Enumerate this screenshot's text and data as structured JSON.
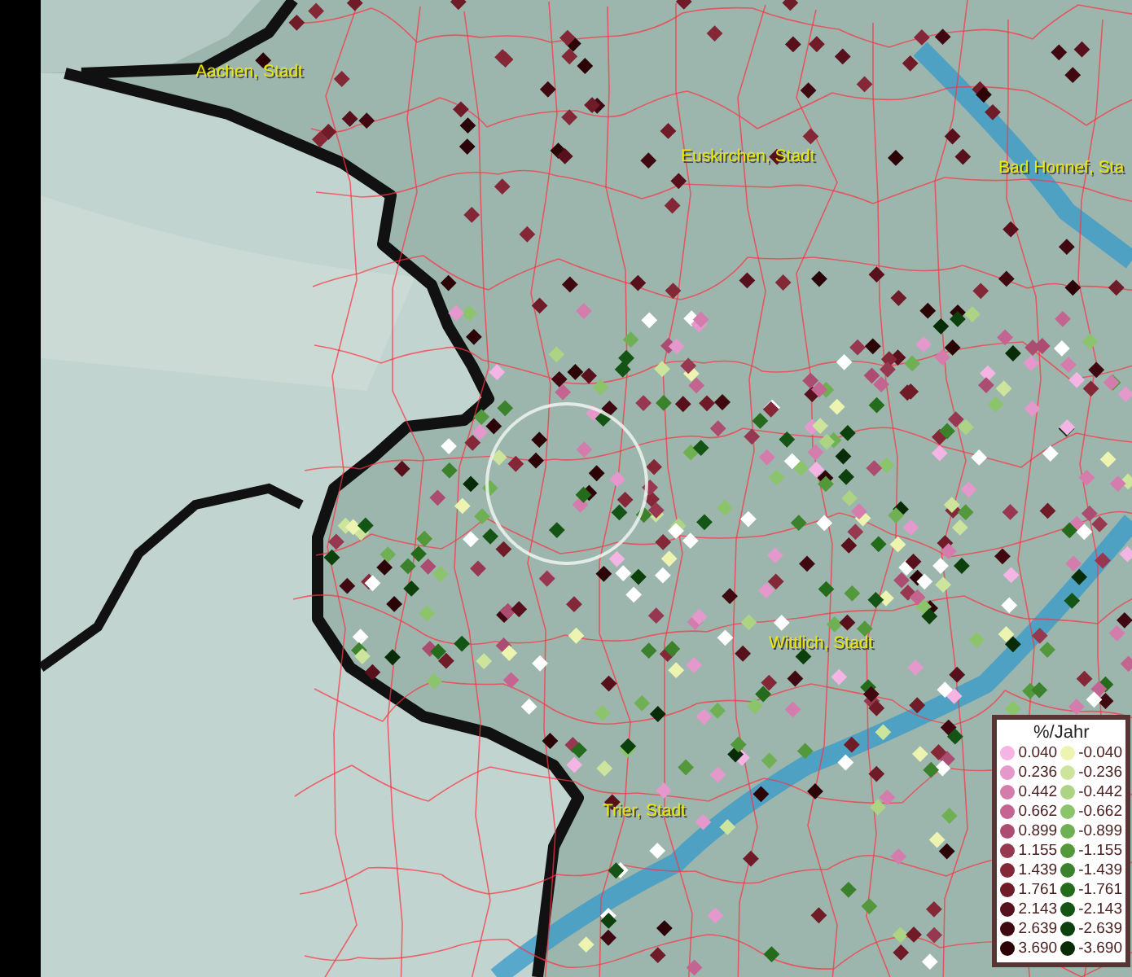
{
  "map": {
    "places": [
      {
        "name": "Aachen, Stadt"
      },
      {
        "name": "Euskirchen, Stadt"
      },
      {
        "name": "Bad Honnef, Sta"
      },
      {
        "name": "Wittlich, Stadt"
      },
      {
        "name": "Trier, Stadt"
      }
    ]
  },
  "legend": {
    "title": "%/Jahr",
    "positive": [
      {
        "value": "0.040",
        "color": "#f4b4e4"
      },
      {
        "value": "0.236",
        "color": "#e498cc"
      },
      {
        "value": "0.442",
        "color": "#d47cac"
      },
      {
        "value": "0.662",
        "color": "#c46490"
      },
      {
        "value": "0.899",
        "color": "#ac4c70"
      },
      {
        "value": "1.155",
        "color": "#983850"
      },
      {
        "value": "1.439",
        "color": "#842838"
      },
      {
        "value": "1.761",
        "color": "#701c28"
      },
      {
        "value": "2.143",
        "color": "#58101c"
      },
      {
        "value": "2.639",
        "color": "#400810"
      },
      {
        "value": "3.690",
        "color": "#2c0408"
      }
    ],
    "negative": [
      {
        "value": "-0.040",
        "color": "#ecf4b0"
      },
      {
        "value": "-0.236",
        "color": "#cce49c"
      },
      {
        "value": "-0.442",
        "color": "#acd484"
      },
      {
        "value": "-0.662",
        "color": "#8cc46c"
      },
      {
        "value": "-0.899",
        "color": "#70b054"
      },
      {
        "value": "-1.155",
        "color": "#54983c"
      },
      {
        "value": "-1.439",
        "color": "#3c822c"
      },
      {
        "value": "-1.761",
        "color": "#246c1c"
      },
      {
        "value": "-2.143",
        "color": "#145414"
      },
      {
        "value": "-2.639",
        "color": "#0c400c"
      },
      {
        "value": "-3.690",
        "color": "#082c08"
      }
    ]
  }
}
